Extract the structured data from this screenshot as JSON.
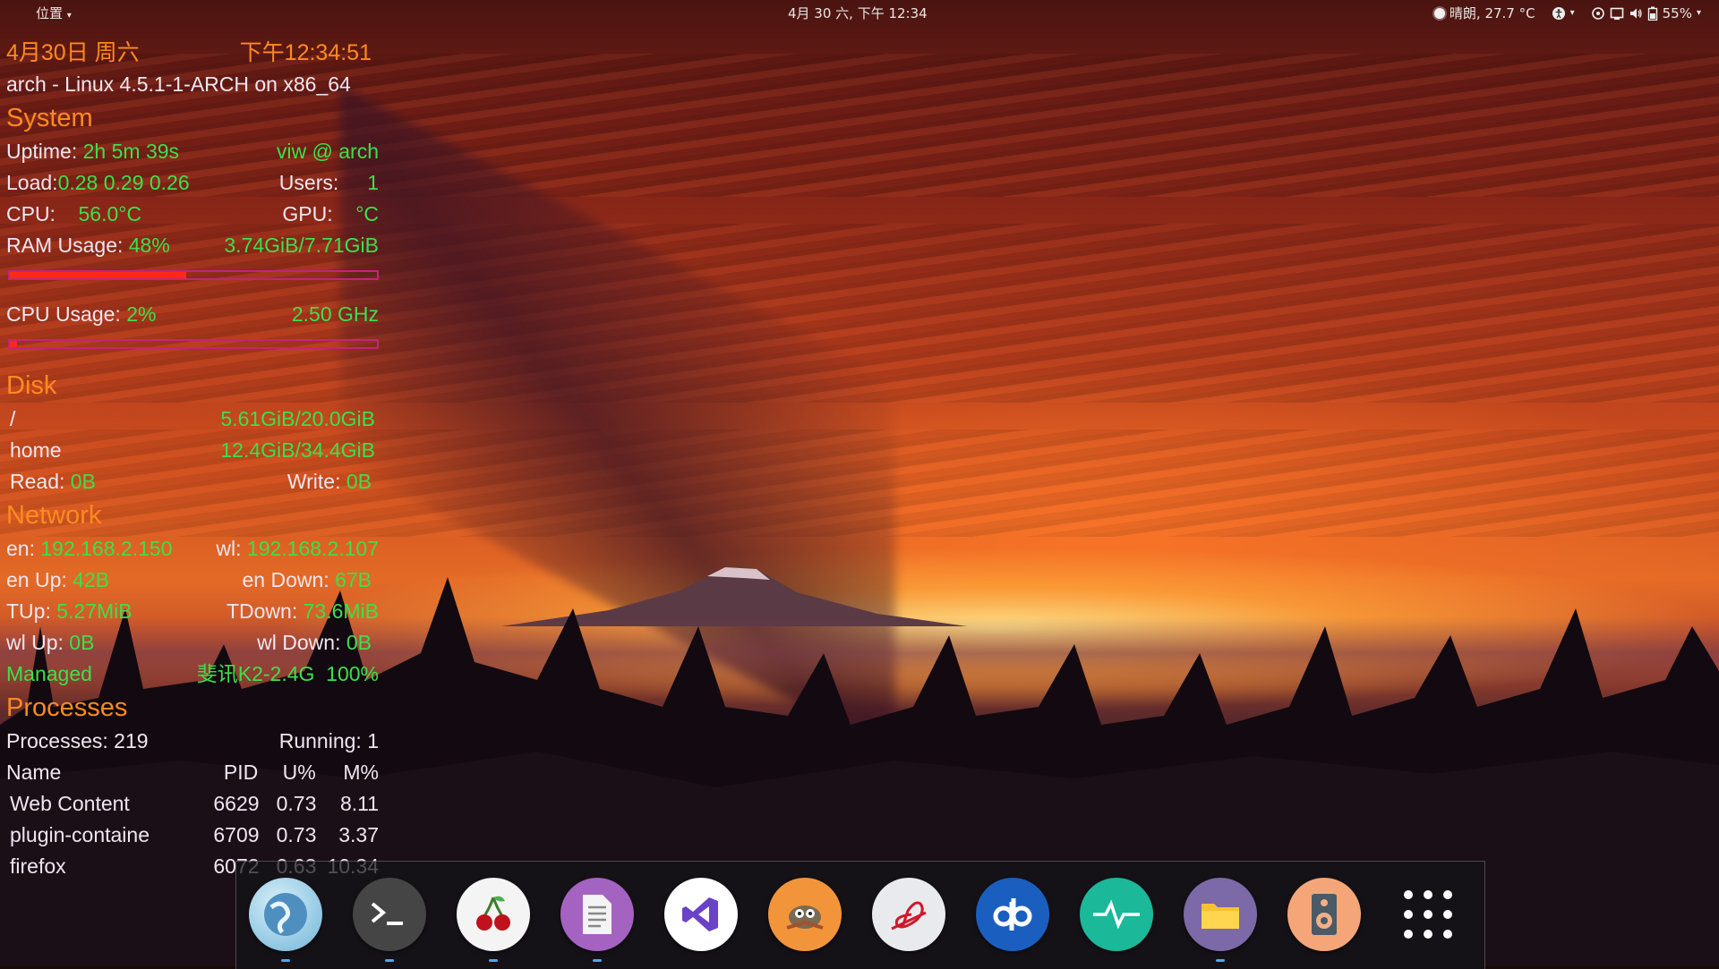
{
  "topbar": {
    "places_label": "位置",
    "clock": "4月 30 六, 下午 12:34",
    "weather": "晴朗, 27.7 °C",
    "battery": "55%"
  },
  "conky": {
    "date": "4月30日 周六",
    "time": "下午12:34:51",
    "kernel": "arch - Linux 4.5.1-1-ARCH on x86_64",
    "system": {
      "header": "System",
      "uptime_label": "Uptime:",
      "uptime": "2h 5m 39s",
      "user_host": "viw @ arch",
      "load_label": "Load:",
      "load": "0.28 0.29 0.26",
      "users_label": "Users:",
      "users": "1",
      "cpu_label": "CPU:",
      "cpu_temp": "56.0°C",
      "gpu_label": "GPU:",
      "gpu_temp": "°C",
      "ram_label": "RAM Usage:",
      "ram_pct": "48%",
      "ram_amount": "3.74GiB/7.71GiB",
      "ram_fraction": 0.48,
      "cpu_usage_label": "CPU Usage:",
      "cpu_usage_pct": "2%",
      "cpu_freq": "2.50 GHz",
      "cpu_fraction": 0.02
    },
    "disk": {
      "header": "Disk",
      "root_label": "/",
      "root_usage": "5.61GiB/20.0GiB",
      "home_label": "home",
      "home_usage": "12.4GiB/34.4GiB",
      "read_label": "Read:",
      "read": "0B",
      "write_label": "Write:",
      "write": "0B"
    },
    "network": {
      "header": "Network",
      "en_label": "en:",
      "en_ip": "192.168.2.150",
      "wl_label": "wl:",
      "wl_ip": "192.168.2.107",
      "en_up_label": "en Up:",
      "en_up": "42B",
      "en_down_label": "en Down:",
      "en_down": "67B",
      "tup_label": "TUp:",
      "tup": "5.27MiB",
      "tdown_label": "TDown:",
      "tdown": "73.6MiB",
      "wl_up_label": "wl Up:",
      "wl_up": "0B",
      "wl_down_label": "wl Down:",
      "wl_down": "0B",
      "status": "Managed",
      "ssid": "斐讯K2-2.4G",
      "signal": "100%"
    },
    "processes": {
      "header": "Processes",
      "count_label": "Processes:",
      "count": "219",
      "running_label": "Running:",
      "running": "1",
      "columns": [
        "Name",
        "PID",
        "U%",
        "M%"
      ],
      "rows": [
        {
          "name": "Web Content",
          "pid": "6629",
          "u": "0.73",
          "m": "8.11"
        },
        {
          "name": "plugin-containe",
          "pid": "6709",
          "u": "0.73",
          "m": "3.37"
        },
        {
          "name": "firefox",
          "pid": "6072",
          "u": "0.63",
          "m": "10.34"
        }
      ]
    }
  },
  "dock": {
    "apps": [
      {
        "name": "web-browser-icon",
        "color": "#9fd3e8",
        "running": true
      },
      {
        "name": "terminal-icon",
        "color": "#4a4a4a",
        "running": true
      },
      {
        "name": "cherrytree-icon",
        "color": "#f2f2f2",
        "running": true
      },
      {
        "name": "text-editor-icon",
        "color": "#9b59b6",
        "running": true
      },
      {
        "name": "visual-studio-code-icon",
        "color": "#ffffff",
        "running": false
      },
      {
        "name": "gimp-icon",
        "color": "#f39c3c",
        "running": false
      },
      {
        "name": "evince-icon",
        "color": "#e8e8ec",
        "running": false
      },
      {
        "name": "qbittorrent-icon",
        "color": "#1565c0",
        "running": false
      },
      {
        "name": "system-monitor-icon",
        "color": "#1abc9c",
        "running": false
      },
      {
        "name": "files-icon",
        "color": "#7b68a6",
        "running": true
      },
      {
        "name": "audio-player-icon",
        "color": "#f5a77a",
        "running": false
      },
      {
        "name": "show-applications-icon",
        "color": "transparent",
        "running": false
      }
    ]
  }
}
